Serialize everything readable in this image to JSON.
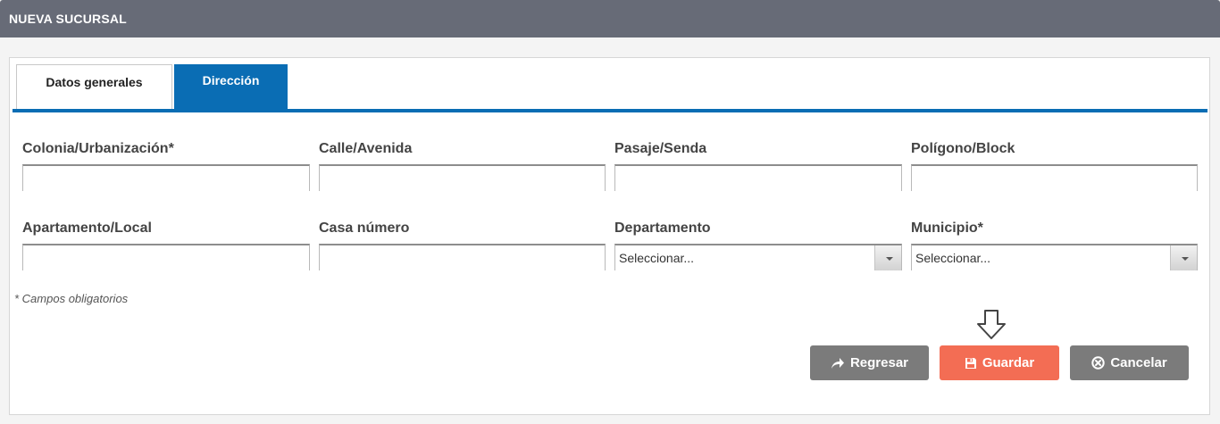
{
  "header": {
    "title": "NUEVA SUCURSAL"
  },
  "tabs": [
    {
      "label": "Datos generales",
      "active": false
    },
    {
      "label": "Dirección",
      "active": true
    }
  ],
  "accent_color": "#0a6db4",
  "fields": {
    "colonia": {
      "label": "Colonia/Urbanización*",
      "value": ""
    },
    "calle": {
      "label": "Calle/Avenida",
      "value": ""
    },
    "pasaje": {
      "label": "Pasaje/Senda",
      "value": ""
    },
    "poligono": {
      "label": "Polígono/Block",
      "value": ""
    },
    "apartamento": {
      "label": "Apartamento/Local",
      "value": ""
    },
    "casa": {
      "label": "Casa número",
      "value": ""
    },
    "departamento": {
      "label": "Departamento",
      "selected": "Seleccionar..."
    },
    "municipio": {
      "label": "Municipio*",
      "selected": "Seleccionar..."
    }
  },
  "note": "* Campos obligatorios",
  "buttons": {
    "regresar": {
      "label": "Regresar",
      "icon": "share-arrow-icon",
      "color": "#7b7b7b"
    },
    "guardar": {
      "label": "Guardar",
      "icon": "floppy-disk-icon",
      "color": "#f36d54"
    },
    "cancelar": {
      "label": "Cancelar",
      "icon": "circle-x-icon",
      "color": "#7b7b7b"
    }
  }
}
